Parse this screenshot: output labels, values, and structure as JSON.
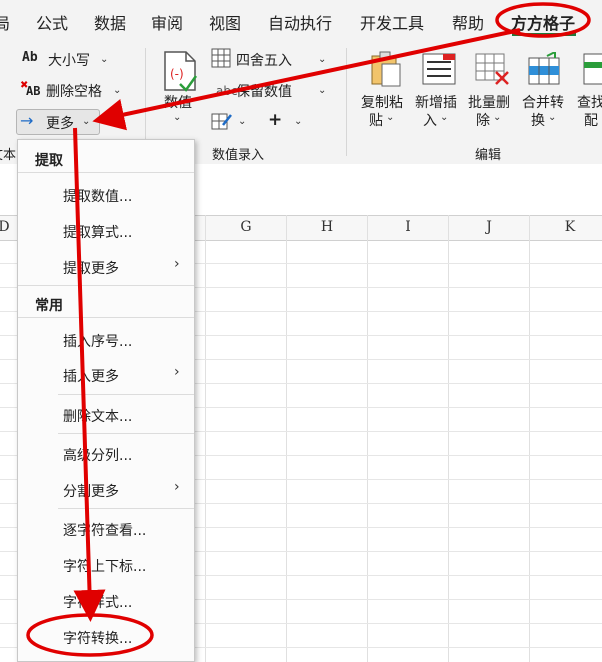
{
  "menubar": {
    "tabs": [
      "局",
      "公式",
      "数据",
      "审阅",
      "视图",
      "自动执行",
      "开发工具",
      "帮助",
      "方方格子"
    ]
  },
  "ribbon": {
    "text_group": {
      "case_label": "大小写",
      "delete_spaces_label": "删除空格",
      "more_label": "更多",
      "group_partial_label": "文本"
    },
    "number_group": {
      "value_label": "数值",
      "round_label": "四舍五入",
      "keep_value_label": "保留数值",
      "plus_label": "+",
      "group_label": "数值录入"
    },
    "edit_group": {
      "copy_paste_label_1": "复制粘",
      "copy_paste_label_2": "贴",
      "insert_label_1": "新增插",
      "insert_label_2": "入",
      "batch_delete_label_1": "批量删",
      "batch_delete_label_2": "除",
      "merge_label_1": "合并转",
      "merge_label_2": "换",
      "find_label_1": "查找",
      "find_label_2": "配",
      "group_label": "编辑"
    }
  },
  "sheet": {
    "columns": [
      "D",
      "G",
      "H",
      "I",
      "J",
      "K"
    ]
  },
  "dropdown": {
    "section_extract": "提取",
    "extract_value": "提取数值...",
    "extract_formula": "提取算式...",
    "extract_more": "提取更多",
    "section_common": "常用",
    "insert_seq": "插入序号...",
    "insert_more": "插入更多",
    "delete_text": "删除文本...",
    "advanced_split": "高级分列...",
    "split_more": "分割更多",
    "char_view": "逐字符查看...",
    "sub_sup": "字符上下标...",
    "char_style": "字符样式...",
    "char_convert": "字符转换..."
  },
  "colors": {
    "annotation_red": "#e00000",
    "tab_underline": "#1f7a3a"
  }
}
